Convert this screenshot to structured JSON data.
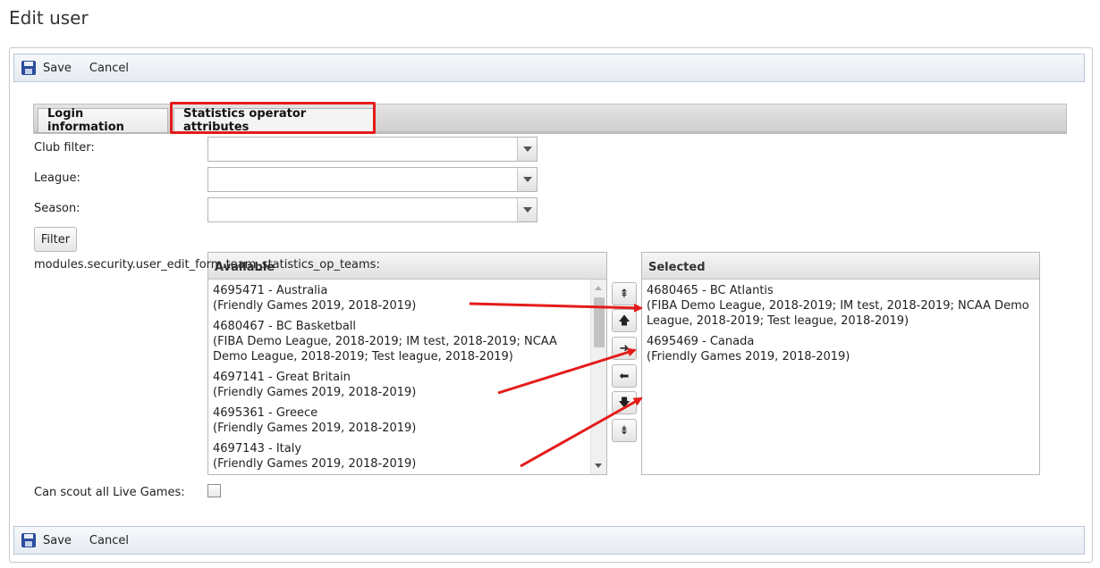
{
  "page": {
    "title": "Edit user"
  },
  "toolbar": {
    "save_label": "Save",
    "cancel_label": "Cancel"
  },
  "tabs": [
    {
      "label": "Login information"
    },
    {
      "label": "Statistics operator attributes"
    }
  ],
  "form": {
    "club_filter_label": "Club filter:",
    "league_label": "League:",
    "season_label": "Season:",
    "club_filter_value": "",
    "league_value": "",
    "season_value": "",
    "filter_button": "Filter",
    "teams_label": "modules.security.user_edit_form.team_statistics_op_teams:",
    "scout_label": "Can scout all Live Games:",
    "scout_checked": false
  },
  "available": {
    "header": "Available",
    "items": [
      {
        "line1": "4695471 - Australia",
        "line2": "(Friendly Games 2019, 2018-2019)"
      },
      {
        "line1": "4680467 - BC Basketball",
        "line2": "(FIBA Demo League, 2018-2019; IM test, 2018-2019; NCAA Demo League, 2018-2019; Test league, 2018-2019)"
      },
      {
        "line1": "4697141 - Great Britain",
        "line2": "(Friendly Games 2019, 2018-2019)"
      },
      {
        "line1": "4695361 - Greece",
        "line2": "(Friendly Games 2019, 2018-2019)"
      },
      {
        "line1": "4697143 - Italy",
        "line2": "(Friendly Games 2019, 2018-2019)"
      }
    ]
  },
  "selected": {
    "header": "Selected",
    "items": [
      {
        "line1": "4680465 - BC Atlantis",
        "line2": "(FIBA Demo League, 2018-2019; IM test, 2018-2019; NCAA Demo League, 2018-2019; Test league, 2018-2019)"
      },
      {
        "line1": "4695469 - Canada",
        "line2": "(Friendly Games 2019, 2018-2019)"
      }
    ]
  },
  "move_buttons": [
    {
      "icon": "move-to-top-icon",
      "glyph": "⇞"
    },
    {
      "icon": "move-up-icon",
      "glyph": "🡅"
    },
    {
      "icon": "move-right-icon",
      "glyph": "➜"
    },
    {
      "icon": "move-left-icon",
      "glyph": "⬅"
    },
    {
      "icon": "move-down-icon",
      "glyph": "🡇"
    },
    {
      "icon": "move-to-bottom-icon",
      "glyph": "⇟"
    }
  ],
  "colors": {
    "annotation_red": "#e51b1b",
    "toolbar_bg": "#e9edf3",
    "tab_bg": "#d9d9d9"
  }
}
